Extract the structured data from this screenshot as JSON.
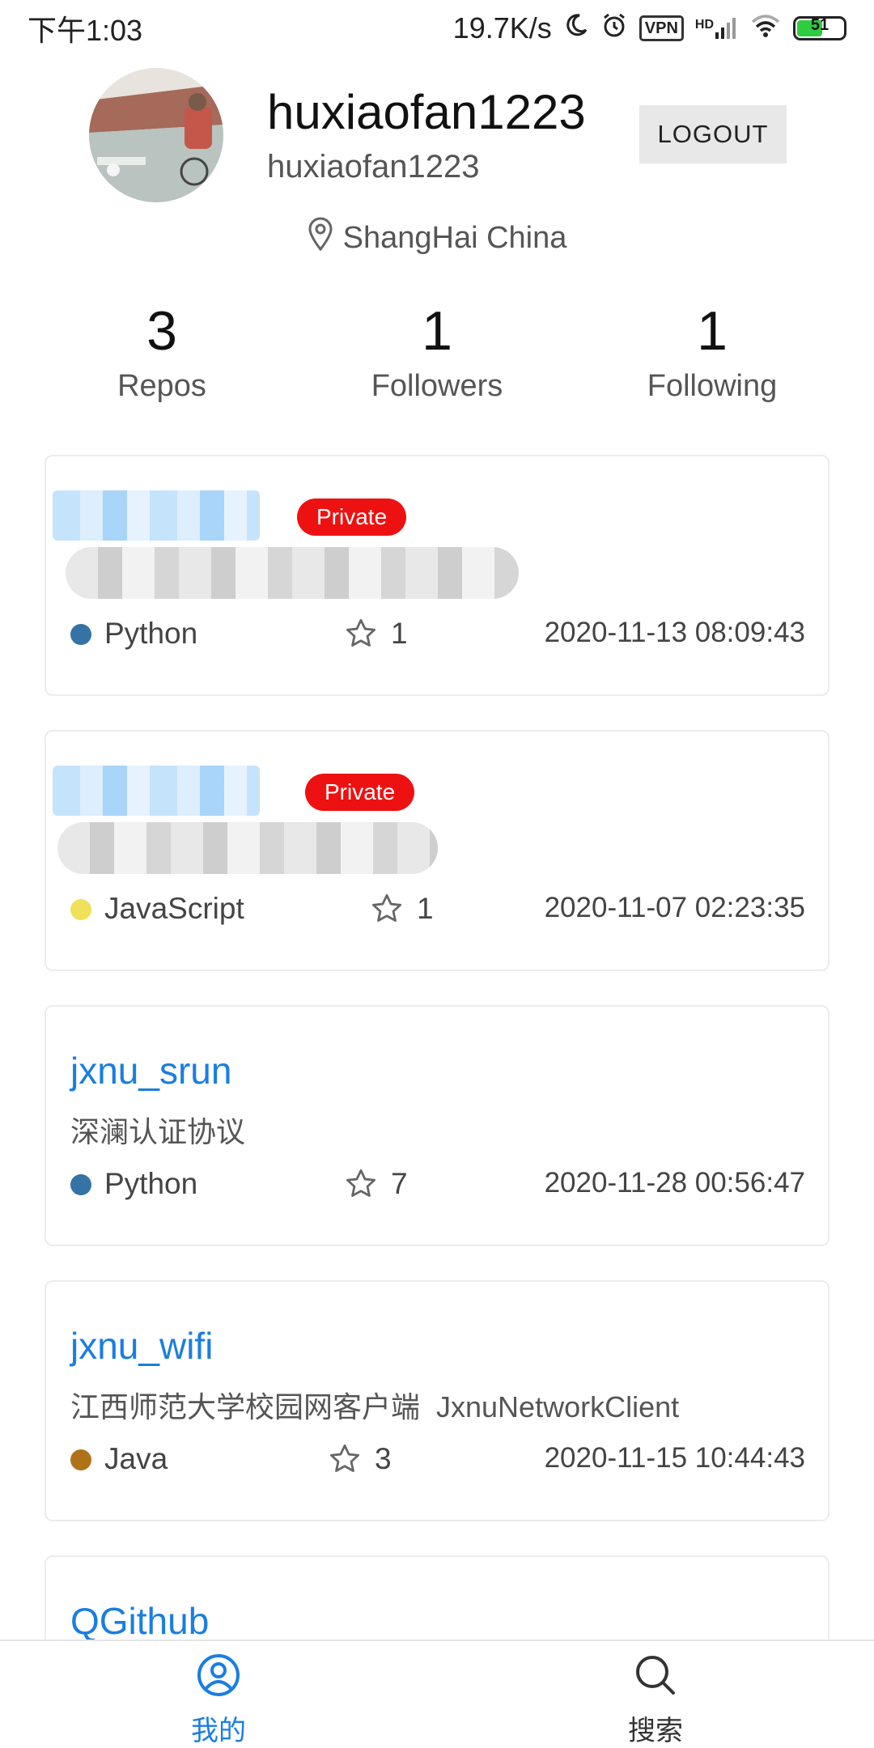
{
  "status_bar": {
    "time": "下午1:03",
    "net_speed": "19.7K/s",
    "vpn": "VPN",
    "hd": "HD",
    "battery": "51"
  },
  "profile": {
    "username": "huxiaofan1223",
    "login": "huxiaofan1223",
    "logout_label": "LOGOUT",
    "location": "ShangHai China"
  },
  "stats": [
    {
      "value": "3",
      "label": "Repos"
    },
    {
      "value": "1",
      "label": "Followers"
    },
    {
      "value": "1",
      "label": "Following"
    }
  ],
  "repos": [
    {
      "name": "",
      "private_label": "Private",
      "description": "",
      "language": "Python",
      "language_color": "#3572A5",
      "stars": "1",
      "updated": "2020-11-13 08:09:43"
    },
    {
      "name": "",
      "private_label": "Private",
      "description": "",
      "language": "JavaScript",
      "language_color": "#f1e05a",
      "stars": "1",
      "updated": "2020-11-07 02:23:35"
    },
    {
      "name": "jxnu_srun",
      "description": "深澜认证协议",
      "language": "Python",
      "language_color": "#3572A5",
      "stars": "7",
      "updated": "2020-11-28 00:56:47"
    },
    {
      "name": "jxnu_wifi",
      "description": "江西师范大学校园网客户端  JxnuNetworkClient",
      "language": "Java",
      "language_color": "#b07219",
      "stars": "3",
      "updated": "2020-11-15 10:44:43"
    },
    {
      "name": "QGithub"
    }
  ],
  "bottom_nav": {
    "mine_label": "我的",
    "search_label": "搜索",
    "active_color": "#1a7ee0"
  }
}
